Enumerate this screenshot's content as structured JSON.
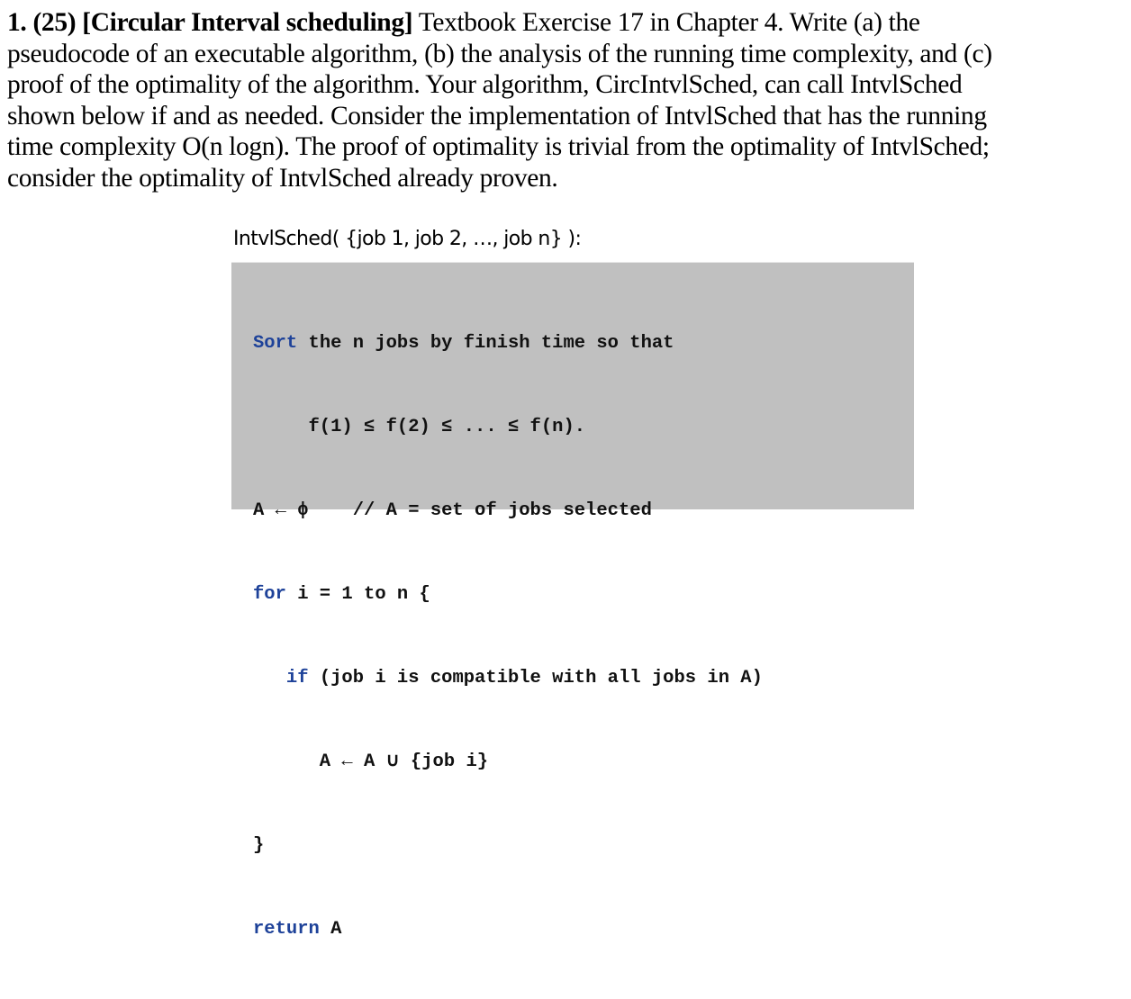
{
  "problem": {
    "heading": "1. (25) [Circular Interval scheduling]",
    "lines": [
      " Textbook Exercise 17 in Chapter 4.  Write (a) the",
      "pseudocode of an executable algorithm, (b) the analysis of the running time complexity, and (c)",
      "proof of the optimality of the algorithm. Your algorithm, CircIntvlSched, can call IntvlSched",
      "shown below if and as needed.  Consider the implementation of IntvlSched that has the running",
      "time complexity O(n logn).  The proof of optimality is trivial from the optimality of IntvlSched;",
      "consider the optimality of IntvlSched already proven."
    ]
  },
  "algorithm": {
    "signature": "IntvlSched( {job 1, job 2, …, job n} ):",
    "code": [
      {
        "kw": "Sort",
        "rest": " the n jobs by finish time so that"
      },
      {
        "kw": "",
        "rest": "     f(1) ≤ f(2) ≤ ... ≤ f(n)."
      },
      {
        "kw": "",
        "rest": "A ← ϕ    // A = set of jobs selected"
      },
      {
        "kw": "for",
        "rest": " i = 1 to n {"
      },
      {
        "kw": "   if",
        "rest": " (job i is compatible with all jobs in A)"
      },
      {
        "kw": "",
        "rest": "      A ← A ∪ {job i}"
      },
      {
        "kw": "",
        "rest": "}"
      },
      {
        "kw": "return",
        "rest": " A"
      }
    ]
  },
  "colors": {
    "code_background": "#c0c0c0",
    "keyword": "#1e4299"
  }
}
